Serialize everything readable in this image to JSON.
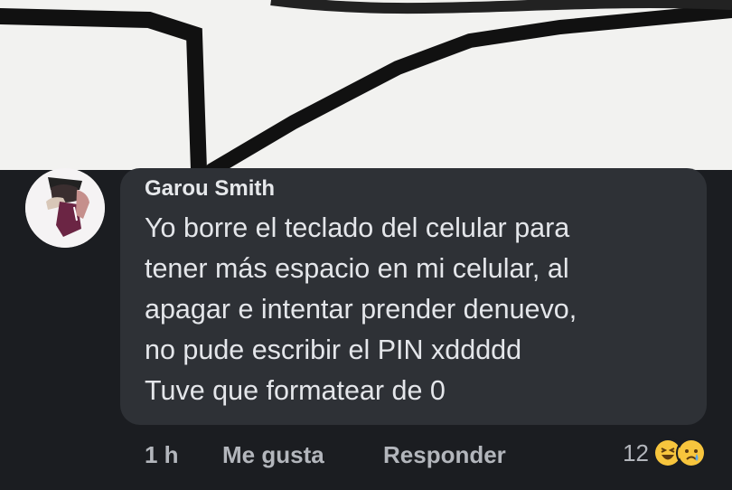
{
  "comment": {
    "author": "Garou Smith",
    "text": "Yo borre el teclado del celular para\ntener más espacio en mi celular, al\napagar e intentar prender denuevo,\nno pude escribir el PIN xddddd\nTuve que formatear de 0",
    "time": "1 h",
    "like_label": "Me gusta",
    "reply_label": "Responder",
    "reaction_count": "12",
    "reactions": [
      "laugh-emoji-icon",
      "sad-emoji-icon"
    ]
  },
  "colors": {
    "background": "#1b1d21",
    "bubble": "#2e3136",
    "text": "#e4e6ea",
    "secondary_text": "#b3b6bc",
    "reaction_yellow": "#f7c53d"
  }
}
